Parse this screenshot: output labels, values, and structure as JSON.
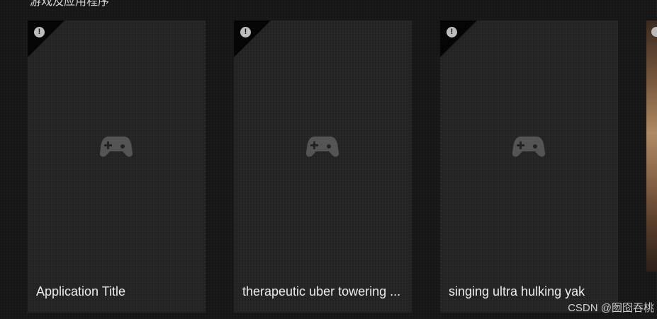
{
  "section": {
    "title": "游戏及应用程序"
  },
  "cards": [
    {
      "title": "Application Title",
      "alert": "!"
    },
    {
      "title": "therapeutic uber towering ...",
      "alert": "!"
    },
    {
      "title": "singing ultra hulking yak",
      "alert": "!"
    },
    {
      "title": "",
      "alert": ""
    }
  ],
  "icons": {
    "placeholder": "gamepad-icon",
    "badge": "alert-icon"
  },
  "watermark": {
    "text": "CSDN @囫囵吞桃"
  },
  "colors": {
    "background": "#161616",
    "card": "#232323",
    "icon": "#545454",
    "title": "#ededed"
  }
}
